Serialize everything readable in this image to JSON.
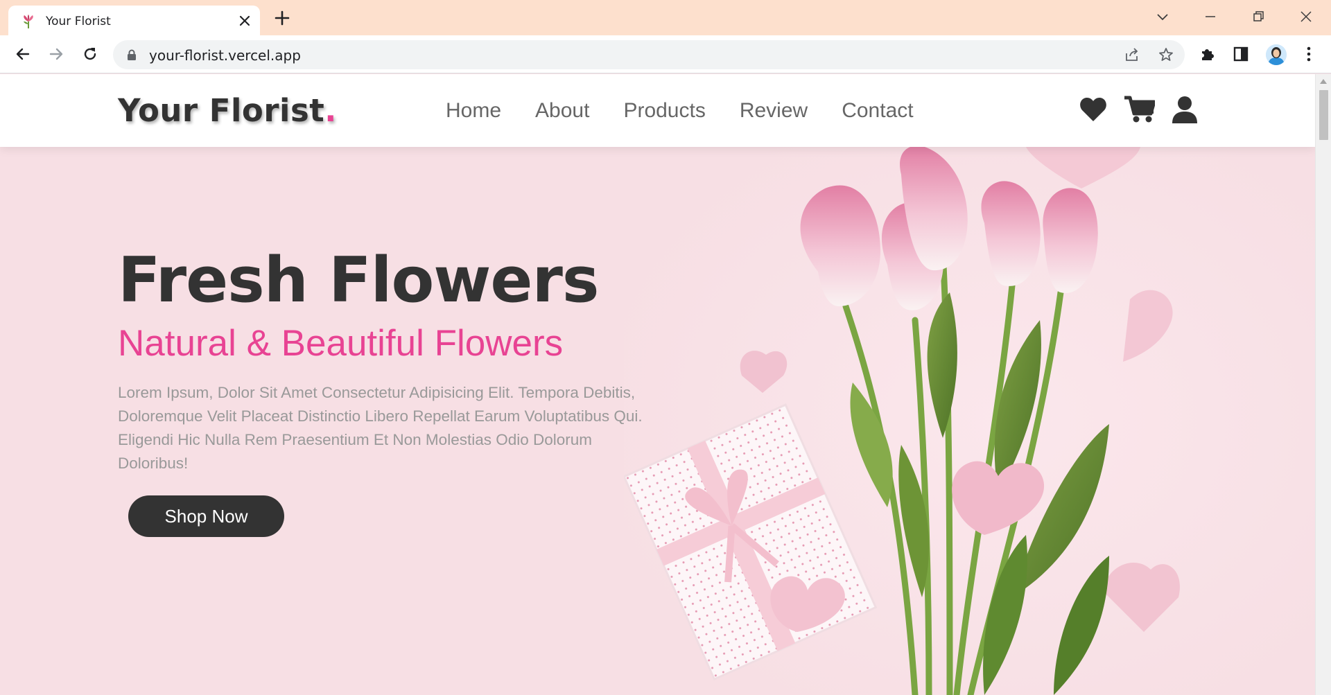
{
  "browser": {
    "tab_title": "Your Florist",
    "url": "your-florist.vercel.app"
  },
  "site": {
    "logo_text": "Your Florist",
    "logo_dot": ".",
    "nav": [
      "Home",
      "About",
      "Products",
      "Review",
      "Contact"
    ],
    "header_icons": [
      "heart-icon",
      "cart-icon",
      "user-icon"
    ]
  },
  "hero": {
    "title": "Fresh Flowers",
    "subtitle": "Natural & Beautiful Flowers",
    "description": "Lorem Ipsum, Dolor Sit Amet Consectetur Adipisicing Elit. Tempora Debitis, Doloremque Velit Placeat Distinctio Libero Repellat Earum Voluptatibus Qui. Eligendi Hic Nulla Rem Praesentium Et Non Molestias Odio Dolorum Doloribus!",
    "button_label": "Shop Now"
  },
  "colors": {
    "accent": "#e84393",
    "dark": "#333333",
    "hero_bg": "#f7dfe4",
    "tabbar_bg": "#fde0cd"
  }
}
